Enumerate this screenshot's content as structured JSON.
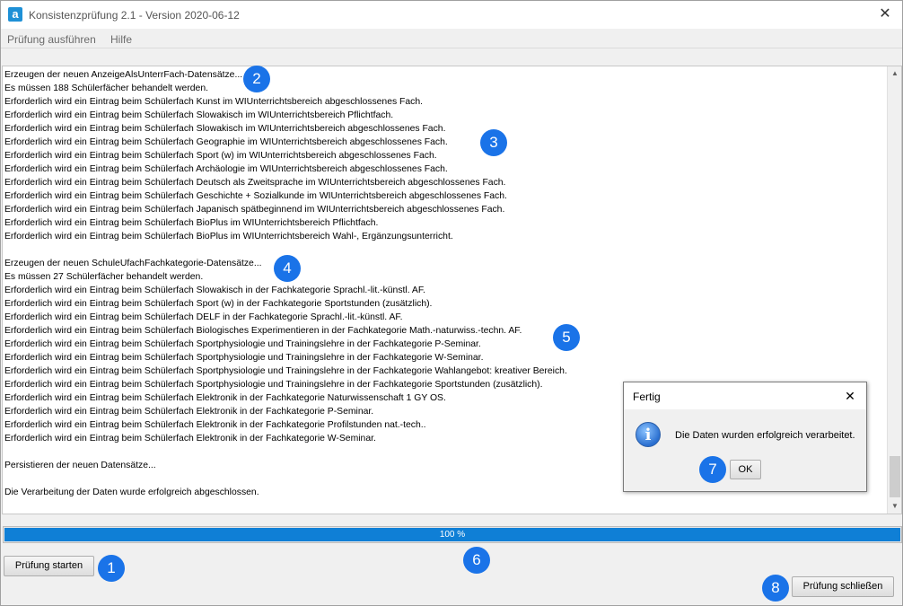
{
  "window": {
    "title": "Konsistenzprüfung 2.1 - Version 2020-06-12",
    "app_icon_letter": "a",
    "close_glyph": "✕"
  },
  "menu": {
    "items": [
      {
        "label": "Prüfung ausführen"
      },
      {
        "label": "Hilfe"
      }
    ]
  },
  "log": {
    "lines": [
      "Erzeugen der neuen AnzeigeAlsUnterrFach-Datensätze...",
      "Es müssen 188 Schülerfächer behandelt werden.",
      "Erforderlich wird ein Eintrag beim Schülerfach Kunst im WIUnterrichtsbereich abgeschlossenes Fach.",
      "Erforderlich wird ein Eintrag beim Schülerfach Slowakisch im WIUnterrichtsbereich Pflichtfach.",
      "Erforderlich wird ein Eintrag beim Schülerfach Slowakisch im WIUnterrichtsbereich abgeschlossenes Fach.",
      "Erforderlich wird ein Eintrag beim Schülerfach Geographie im WIUnterrichtsbereich abgeschlossenes Fach.",
      "Erforderlich wird ein Eintrag beim Schülerfach Sport (w) im WIUnterrichtsbereich abgeschlossenes Fach.",
      "Erforderlich wird ein Eintrag beim Schülerfach Archäologie im WIUnterrichtsbereich abgeschlossenes Fach.",
      "Erforderlich wird ein Eintrag beim Schülerfach Deutsch als Zweitsprache im WIUnterrichtsbereich abgeschlossenes Fach.",
      "Erforderlich wird ein Eintrag beim Schülerfach Geschichte + Sozialkunde im WIUnterrichtsbereich abgeschlossenes Fach.",
      "Erforderlich wird ein Eintrag beim Schülerfach Japanisch spätbeginnend im WIUnterrichtsbereich abgeschlossenes Fach.",
      "Erforderlich wird ein Eintrag beim Schülerfach BioPlus im WIUnterrichtsbereich Pflichtfach.",
      "Erforderlich wird ein Eintrag beim Schülerfach BioPlus im WIUnterrichtsbereich Wahl-, Ergänzungsunterricht.",
      "",
      "Erzeugen der neuen SchuleUfachFachkategorie-Datensätze...",
      "Es müssen 27 Schülerfächer behandelt werden.",
      "Erforderlich wird ein Eintrag beim Schülerfach Slowakisch in der Fachkategorie Sprachl.-lit.-künstl. AF.",
      "Erforderlich wird ein Eintrag beim Schülerfach Sport (w) in der Fachkategorie Sportstunden (zusätzlich).",
      "Erforderlich wird ein Eintrag beim Schülerfach DELF in der Fachkategorie Sprachl.-lit.-künstl. AF.",
      "Erforderlich wird ein Eintrag beim Schülerfach Biologisches Experimentieren in der Fachkategorie Math.-naturwiss.-techn. AF.",
      "Erforderlich wird ein Eintrag beim Schülerfach Sportphysiologie und Trainingslehre in der Fachkategorie P-Seminar.",
      "Erforderlich wird ein Eintrag beim Schülerfach Sportphysiologie und Trainingslehre in der Fachkategorie W-Seminar.",
      "Erforderlich wird ein Eintrag beim Schülerfach Sportphysiologie und Trainingslehre in der Fachkategorie Wahlangebot: kreativer Bereich.",
      "Erforderlich wird ein Eintrag beim Schülerfach Sportphysiologie und Trainingslehre in der Fachkategorie Sportstunden (zusätzlich).",
      "Erforderlich wird ein Eintrag beim Schülerfach Elektronik in der Fachkategorie Naturwissenschaft 1 GY OS.",
      "Erforderlich wird ein Eintrag beim Schülerfach Elektronik in der Fachkategorie P-Seminar.",
      "Erforderlich wird ein Eintrag beim Schülerfach Elektronik in der Fachkategorie Profilstunden nat.-tech..",
      "Erforderlich wird ein Eintrag beim Schülerfach Elektronik in der Fachkategorie W-Seminar.",
      "",
      "Persistieren der neuen Datensätze...",
      "",
      "Die Verarbeitung der Daten wurde erfolgreich abgeschlossen."
    ]
  },
  "progress": {
    "value": 1.0,
    "label": "100 %",
    "color": "#0f7fd6"
  },
  "buttons": {
    "start": "Prüfung starten",
    "close": "Prüfung schließen"
  },
  "dialog": {
    "title": "Fertig",
    "close_glyph": "✕",
    "icon": "info-icon",
    "icon_glyph": "i",
    "message": "Die Daten wurden erfolgreich verarbeitet.",
    "ok_label": "OK"
  },
  "annotations": {
    "color": "#1a73e8",
    "badges": [
      "1",
      "2",
      "3",
      "4",
      "5",
      "6",
      "7",
      "8"
    ]
  }
}
